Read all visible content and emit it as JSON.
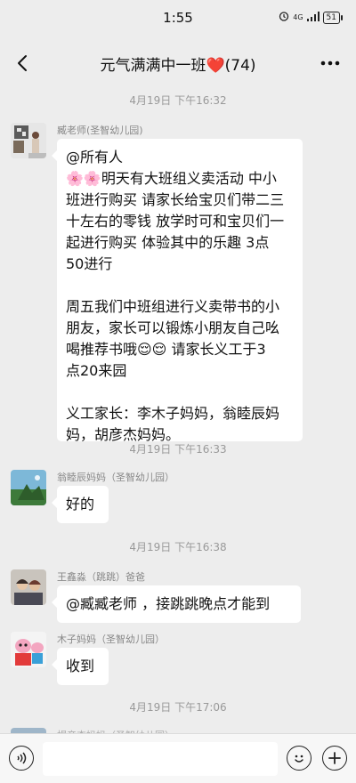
{
  "status_bar": {
    "time": "1:55",
    "signal": "4G",
    "battery": "51"
  },
  "header": {
    "title": "元气满满中一班❤️(74)"
  },
  "timestamps": [
    "4月19日 下午16:32",
    "4月19日 下午16:33",
    "4月19日 下午16:38",
    "4月19日 下午17:06"
  ],
  "messages": [
    {
      "sender": "臧老师(圣智幼儿园)",
      "lines": [
        "@所有人",
        "🌸🌸明天有大班组义卖活动 中小",
        "班进行购买 请家长给宝贝们带二三",
        "十左右的零钱 放学时可和宝贝们一",
        "起进行购买 体验其中的乐趣 3点",
        "50进行",
        "",
        " 周五我们中班组进行义卖带书的小",
        "朋友，家长可以锻炼小朋友自己吆",
        "喝推荐书哦😌😌 请家长义工于3",
        "点20来园",
        "",
        "义工家长：李木子妈妈，翁睦辰妈",
        "妈，胡彦杰妈妈。"
      ]
    },
    {
      "sender": "翁睦辰妈妈（圣智幼儿园）",
      "text": "好的"
    },
    {
      "sender": "王鑫淼（跳跳）爸爸",
      "text": "@臧臧老师 ，接跳跳晚点才能到"
    },
    {
      "sender": "木子妈妈（圣智幼儿园）",
      "text": "收到"
    },
    {
      "sender": "楊彦杰妈妈（圣智幼儿园）"
    }
  ],
  "colors": {
    "background": "#ededed",
    "bubble": "#ffffff",
    "meta_text": "#999999"
  },
  "icons": [
    "back-arrow-icon",
    "more-dots-icon",
    "voice-icon",
    "emoji-icon",
    "plus-icon"
  ]
}
